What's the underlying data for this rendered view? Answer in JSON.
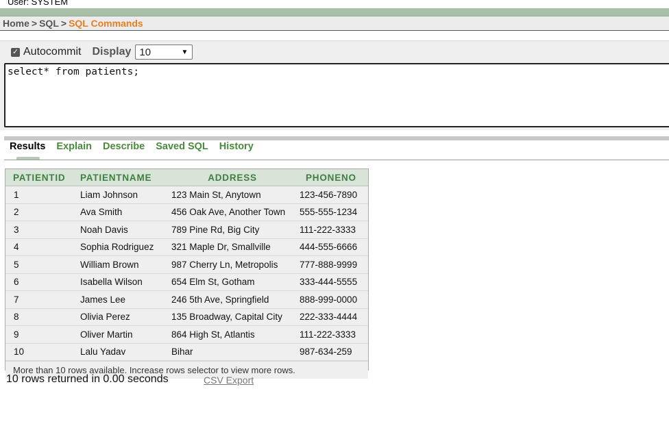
{
  "header": {
    "user_label": "User: SYSTEM"
  },
  "breadcrumb": {
    "home": "Home",
    "sql": "SQL",
    "current": "SQL Commands",
    "separator": ">"
  },
  "options": {
    "autocommit_label": "Autocommit",
    "autocommit_checked": true,
    "display_label": "Display",
    "display_value": "10"
  },
  "editor": {
    "sql": "select* from patients;"
  },
  "tabs": [
    {
      "label": "Results",
      "active": true
    },
    {
      "label": "Explain",
      "active": false
    },
    {
      "label": "Describe",
      "active": false
    },
    {
      "label": "Saved SQL",
      "active": false
    },
    {
      "label": "History",
      "active": false
    }
  ],
  "results": {
    "columns": [
      "PATIENTID",
      "PATIENTNAME",
      "ADDRESS",
      "PHONENO"
    ],
    "rows": [
      [
        "1",
        "Liam Johnson",
        "123 Main St, Anytown",
        "123-456-7890"
      ],
      [
        "2",
        "Ava Smith",
        "456 Oak Ave, Another Town",
        "555-555-1234"
      ],
      [
        "3",
        "Noah Davis",
        "789 Pine Rd, Big City",
        "111-222-3333"
      ],
      [
        "4",
        "Sophia Rodriguez",
        "321 Maple Dr, Smallville",
        "444-555-6666"
      ],
      [
        "5",
        "William Brown",
        "987 Cherry Ln, Metropolis",
        "777-888-9999"
      ],
      [
        "6",
        "Isabella Wilson",
        "654 Elm St, Gotham",
        "333-444-5555"
      ],
      [
        "7",
        "James Lee",
        "246 5th Ave, Springfield",
        "888-999-0000"
      ],
      [
        "8",
        "Olivia Perez",
        "135 Broadway, Capital City",
        "222-333-4444"
      ],
      [
        "9",
        "Oliver Martin",
        "864 High St, Atlantis",
        "111-222-3333"
      ],
      [
        "10",
        "Lalu Yadav",
        "Bihar",
        "987-634-259"
      ]
    ],
    "more_rows_note": "More than 10 rows available. Increase rows selector to view more rows."
  },
  "footer": {
    "rows_returned": "10 rows returned in 0.00 seconds",
    "csv_export": "CSV Export"
  },
  "colors": {
    "accent_orange": "#e67e22",
    "tab_green": "#4a8a3d",
    "header_green": "#3f7f3f",
    "band_green": "#a9c1a9"
  }
}
